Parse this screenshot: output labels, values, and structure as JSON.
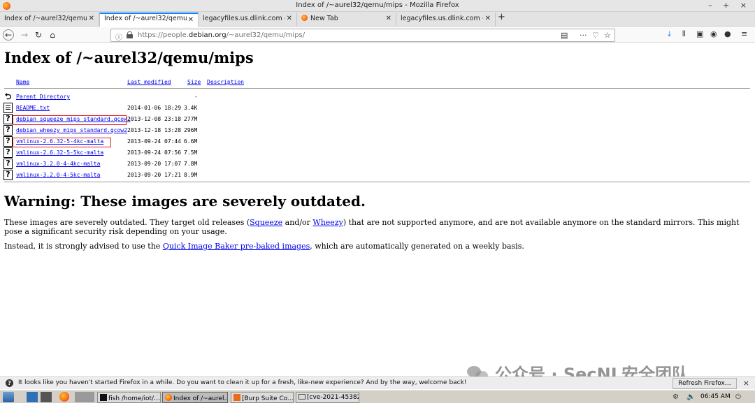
{
  "window": {
    "title": "Index of /~aurel32/qemu/mips - Mozilla Firefox",
    "controls": "– + ×"
  },
  "tabs": [
    {
      "label": "Index of /~aurel32/qemu/ar",
      "active": false
    },
    {
      "label": "Index of /~aurel32/qemu/m",
      "active": true
    },
    {
      "label": "legacyfiles.us.dlink.com - /D",
      "active": false
    },
    {
      "label": "New Tab",
      "active": false
    },
    {
      "label": "legacyfiles.us.dlink.com - /D",
      "active": false
    }
  ],
  "navbar": {
    "url_prefix": "https://people.",
    "url_domain": "debian.org",
    "url_path": "/~aurel32/qemu/mips/"
  },
  "page": {
    "heading": "Index of /~aurel32/qemu/mips",
    "columns": {
      "name": "Name",
      "modified": "Last modified",
      "size": "Size",
      "description": "Description"
    },
    "rows": [
      {
        "icon": "back",
        "name": "Parent Directory",
        "date": "",
        "size": "-"
      },
      {
        "icon": "text",
        "name": "README.txt",
        "date": "2014-01-06 18:29",
        "size": "3.4K"
      },
      {
        "icon": "unknown",
        "name": "debian_squeeze_mips_standard.qcow2",
        "date": "2013-12-08 23:18",
        "size": "277M"
      },
      {
        "icon": "unknown",
        "name": "debian_wheezy_mips_standard.qcow2",
        "date": "2013-12-18 13:28",
        "size": "296M"
      },
      {
        "icon": "unknown",
        "name": "vmlinux-2.6.32-5-4kc-malta",
        "date": "2013-09-24 07:44",
        "size": "6.6M"
      },
      {
        "icon": "unknown",
        "name": "vmlinux-2.6.32-5-5kc-malta",
        "date": "2013-09-24 07:56",
        "size": "7.5M"
      },
      {
        "icon": "unknown",
        "name": "vmlinux-3.2.0-4-4kc-malta",
        "date": "2013-09-20 17:07",
        "size": "7.8M"
      },
      {
        "icon": "unknown",
        "name": "vmlinux-3.2.0-4-5kc-malta",
        "date": "2013-09-20 17:21",
        "size": "8.9M"
      }
    ],
    "warning_heading": "Warning: These images are severely outdated.",
    "para1": {
      "t1": "These images are severely outdated. They target old releases (",
      "link1": "Squeeze",
      "t2": " and/or ",
      "link2": "Wheezy",
      "t3": ") that are not supported anymore, and are not available anymore on the standard mirrors. This might pose a significant security risk depending on your usage."
    },
    "para2": {
      "t1": "Instead, it is strongly advised to use the ",
      "link": "Quick Image Baker pre-baked images",
      "t2": ", which are automatically generated on a weekly basis."
    }
  },
  "notification": {
    "message": "It looks like you haven't started Firefox in a while. Do you want to clean it up for a fresh, like-new experience? And by the way, welcome back!",
    "button": "Refresh Firefox…",
    "close": "×"
  },
  "watermark": {
    "text": "公众号 · SecNL安全团队"
  },
  "taskbar": {
    "items": [
      {
        "label": "fish /home/iot/…"
      },
      {
        "label": "Index of /~aurel…"
      },
      {
        "label": "[Burp Suite Co…"
      },
      {
        "label": "[cve-2021-45382]"
      }
    ],
    "clock": "06:45 AM"
  }
}
